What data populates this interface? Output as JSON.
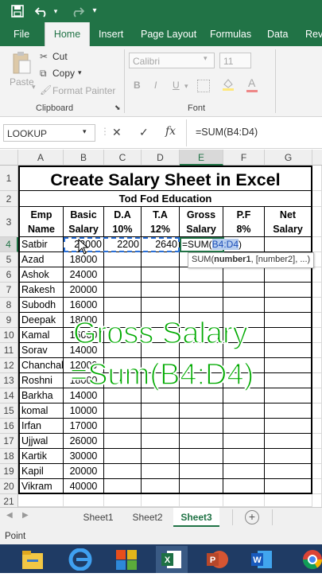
{
  "quick_access": {
    "save_icon": "save-icon",
    "undo_icon": "undo-icon",
    "redo_icon": "redo-icon",
    "customize_icon": "customize-icon"
  },
  "ribbon_tabs": [
    "File",
    "Home",
    "Insert",
    "Page Layout",
    "Formulas",
    "Data",
    "Revi"
  ],
  "ribbon": {
    "paste_label": "Paste",
    "cut_label": "Cut",
    "copy_label": "Copy",
    "format_painter_label": "Format Painter",
    "clipboard_group": "Clipboard",
    "font_name": "Calibri",
    "font_size": "11",
    "bold": "B",
    "italic": "I",
    "underline": "U",
    "font_group": "Font"
  },
  "formula_bar": {
    "name_box": "LOOKUP",
    "cancel": "✕",
    "enter": "✓",
    "fx": "fx",
    "formula": "=SUM(B4:D4)"
  },
  "columns": [
    "A",
    "B",
    "C",
    "D",
    "E",
    "F",
    "G"
  ],
  "rows": [
    "1",
    "2",
    "3",
    "4",
    "5",
    "6",
    "7",
    "8",
    "9",
    "10",
    "11",
    "12",
    "13",
    "14",
    "15",
    "16",
    "17",
    "18",
    "19",
    "20",
    "21"
  ],
  "sheet": {
    "title": "Create Salary Sheet in Excel",
    "subtitle": "Tod Fod Education",
    "headers": [
      {
        "line1": "Emp",
        "line2": "Name"
      },
      {
        "line1": "Basic",
        "line2": "Salary"
      },
      {
        "line1": "D.A",
        "line2": "10%"
      },
      {
        "line1": "T.A",
        "line2": "12%"
      },
      {
        "line1": "Gross",
        "line2": "Salary"
      },
      {
        "line1": "P.F",
        "line2": "8%"
      },
      {
        "line1": "Net",
        "line2": "Salary"
      }
    ],
    "row4": {
      "name": "Satbir",
      "basic": "22000",
      "da": "2200",
      "ta": "2640",
      "gross_prefix": "=SUM(",
      "gross_ref": "B4:D4",
      "gross_suffix": ")"
    },
    "employees": [
      {
        "name": "Azad",
        "basic": "18000"
      },
      {
        "name": "Ashok",
        "basic": "24000"
      },
      {
        "name": "Rakesh",
        "basic": "20000"
      },
      {
        "name": "Subodh",
        "basic": "16000"
      },
      {
        "name": "Deepak",
        "basic": "18000"
      },
      {
        "name": "Kamal",
        "basic": "16000"
      },
      {
        "name": "Sorav",
        "basic": "14000"
      },
      {
        "name": "Chanchal",
        "basic": "12000"
      },
      {
        "name": "Roshni",
        "basic": "18000"
      },
      {
        "name": "Barkha",
        "basic": "14000"
      },
      {
        "name": "komal",
        "basic": "10000"
      },
      {
        "name": "Irfan",
        "basic": "17000"
      },
      {
        "name": "Ujjwal",
        "basic": "26000"
      },
      {
        "name": "Kartik",
        "basic": "30000"
      },
      {
        "name": "Kapil",
        "basic": "20000"
      },
      {
        "name": "Vikram",
        "basic": "40000"
      }
    ]
  },
  "tooltip": {
    "fn": "SUM(",
    "arg1": "number1",
    ", [number2], ...)": "",
    "rest": ", [number2], ...)"
  },
  "overlay": {
    "line1": "Gross Salary",
    "line2": "=Sum(B4:D4)"
  },
  "sheet_tabs": [
    "Sheet1",
    "Sheet2",
    "Sheet3"
  ],
  "active_sheet": "Sheet3",
  "status": "Point",
  "colors": {
    "excel_green": "#217346",
    "selection_blue": "#3c6fd1",
    "overlay_green": "#00aa00"
  }
}
